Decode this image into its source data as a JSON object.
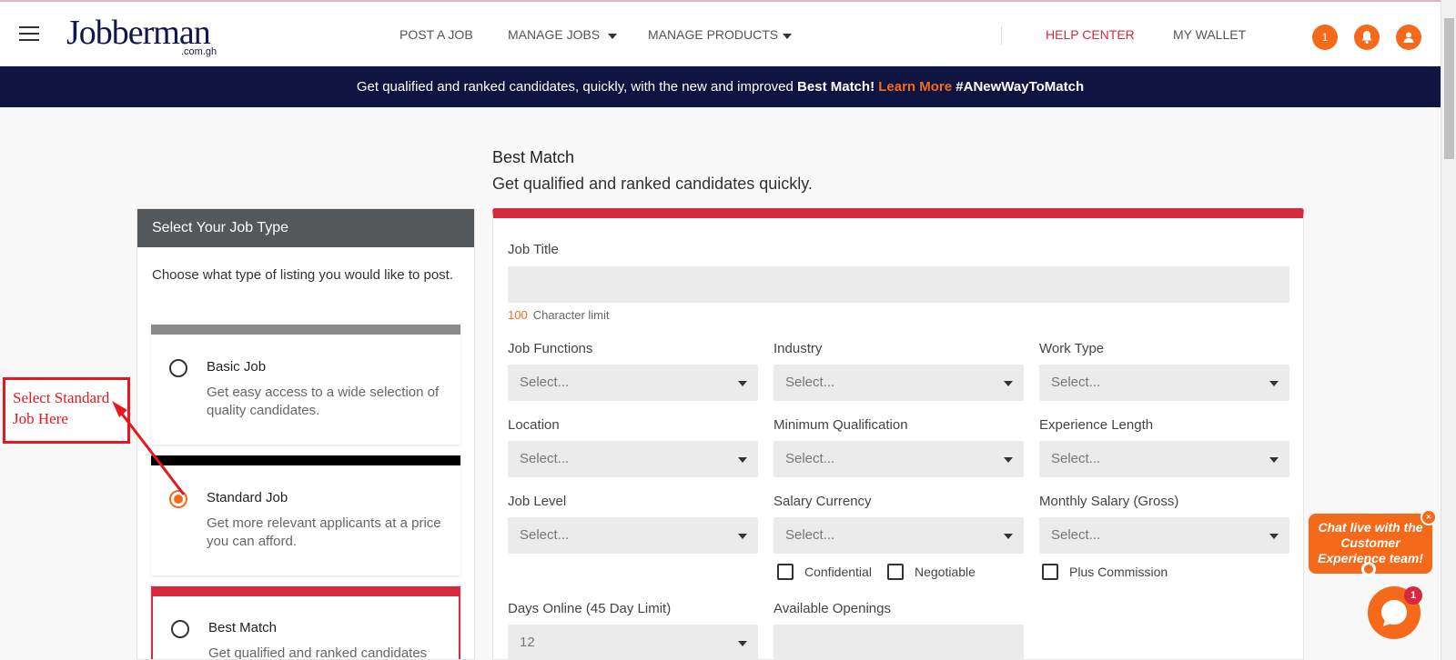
{
  "header": {
    "logo_text": "Jobberman",
    "logo_sub": ".com.gh",
    "nav": [
      "POST A JOB",
      "MANAGE JOBS",
      "MANAGE PRODUCTS"
    ],
    "help": "HELP CENTER",
    "wallet": "MY WALLET",
    "notification_count": "1"
  },
  "banner": {
    "text": "Get qualified and ranked candidates, quickly, with the new and improved ",
    "bold": "Best Match!",
    "learn": "Learn More",
    "hashtag": "#ANewWayToMatch"
  },
  "left": {
    "heading": "Select Your Job Type",
    "description": "Choose what type of listing you would like to post.",
    "cards": [
      {
        "title": "Basic Job",
        "desc": "Get easy access to a wide selection of quality candidates.",
        "bar_color": "#8a8a8a",
        "selected": false
      },
      {
        "title": "Standard Job",
        "desc": "Get more relevant applicants at a price you can afford.",
        "bar_color": "#000000",
        "selected": true
      },
      {
        "title": "Best Match",
        "desc": "Get qualified and ranked candidates",
        "bar_color": "#d7283e",
        "selected": false
      }
    ]
  },
  "form": {
    "title": "Best Match",
    "subtitle": "Get qualified and ranked candidates quickly.",
    "job_title_label": "Job Title",
    "char_limit_num": "100",
    "char_limit_text": "Character limit",
    "labels": {
      "job_functions": "Job Functions",
      "industry": "Industry",
      "work_type": "Work Type",
      "location": "Location",
      "min_qual": "Minimum Qualification",
      "experience": "Experience Length",
      "job_level": "Job Level",
      "salary_currency": "Salary Currency",
      "monthly_salary": "Monthly Salary (Gross)",
      "days_online": "Days Online (45 Day Limit)",
      "openings": "Available Openings"
    },
    "select_placeholder": "Select...",
    "days_online_value": "12",
    "checkboxes": {
      "confidential": "Confidential",
      "negotiable": "Negotiable",
      "commission": "Plus Commission"
    }
  },
  "annotation": {
    "line1": "Select Standard",
    "line2": "Job Here"
  },
  "chat": {
    "text": "Chat live with the Customer Experience team!",
    "close": "×",
    "badge": "1"
  },
  "colors": {
    "accent": "#f56a1a",
    "brand_red": "#d7283e",
    "banner_bg": "#0f1440"
  }
}
